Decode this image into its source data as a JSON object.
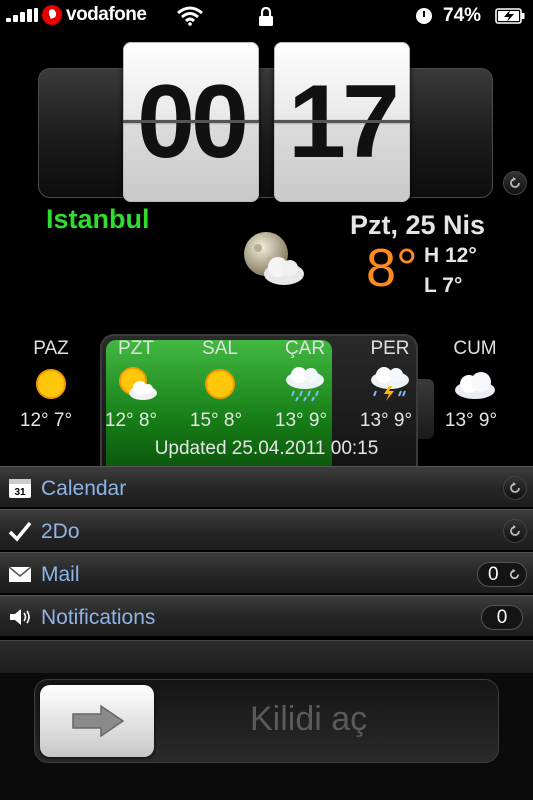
{
  "status_bar": {
    "carrier": "vodafone",
    "battery_percent": "74%",
    "icons": [
      "signal-icon",
      "vodafone-logo",
      "wifi-icon",
      "lock-icon",
      "alarm-clock-icon",
      "battery-charging-icon"
    ]
  },
  "clock": {
    "hours": "00",
    "minutes": "17"
  },
  "weather": {
    "city": "Istanbul",
    "date": "Pzt, 25 Nis",
    "current_temp": "8°",
    "high": "H 12°",
    "low": "L 7°",
    "condition_icon": "moon-cloud-icon"
  },
  "forecast": [
    {
      "day": "PAZ",
      "temps": "12° 7°",
      "icon": "sun-icon"
    },
    {
      "day": "PZT",
      "temps": "12° 8°",
      "icon": "sun-cloud-icon"
    },
    {
      "day": "SAL",
      "temps": "15° 8°",
      "icon": "sun-icon"
    },
    {
      "day": "ÇAR",
      "temps": "13° 9°",
      "icon": "rain-cloud-icon"
    },
    {
      "day": "PER",
      "temps": "13° 9°",
      "icon": "thunder-cloud-icon"
    },
    {
      "day": "CUM",
      "temps": "13° 9°",
      "icon": "cloud-icon"
    }
  ],
  "updated": "Updated 25.04.2011 00:15",
  "battery_overlay": {
    "level_fraction": 0.74
  },
  "rows": [
    {
      "label": "Calendar",
      "icon": "calendar-icon",
      "calendar_day": "31"
    },
    {
      "label": "2Do",
      "icon": "checkmark-icon"
    },
    {
      "label": "Mail",
      "icon": "mail-icon",
      "count": "0"
    },
    {
      "label": "Notifications",
      "icon": "speaker-icon",
      "count": "0"
    }
  ],
  "unlock": {
    "label": "Kilidi aç"
  },
  "colors": {
    "city": "#2fdc2f",
    "temp": "#ff8a1e",
    "row_label": "#8fb4e8"
  }
}
